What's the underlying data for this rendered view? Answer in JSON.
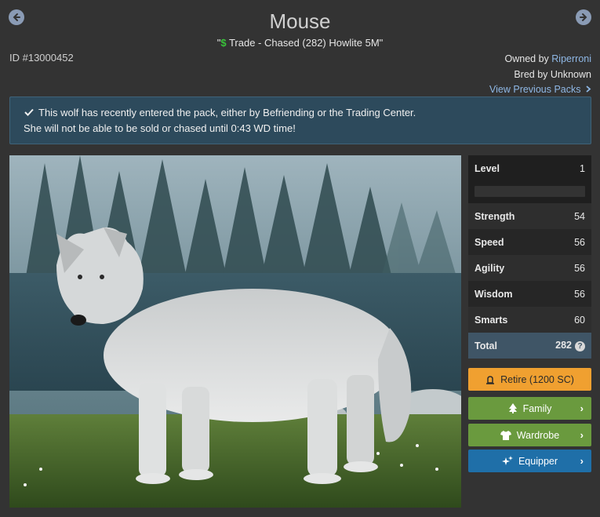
{
  "header": {
    "title": "Mouse",
    "subtitle_prefix": "\"",
    "subtitle_dollar": "$",
    "subtitle_text": " Trade - Chased (282) Howlite 5M\"",
    "wolf_id": "ID #13000452"
  },
  "owner": {
    "owned_by_label": "Owned by ",
    "owner_name": "Riperroni",
    "bred_by": "Bred by Unknown",
    "view_previous": "View Previous Packs"
  },
  "notice": {
    "line1": "This wolf has recently entered the pack, either by Befriending or the Trading Center.",
    "line2": "She will not be able to be sold or chased until 0:43 WD time!"
  },
  "stats": {
    "level_label": "Level",
    "level_value": "1",
    "xp_fraction": 0,
    "rows": [
      {
        "label": "Strength",
        "value": "54"
      },
      {
        "label": "Speed",
        "value": "56"
      },
      {
        "label": "Agility",
        "value": "56"
      },
      {
        "label": "Wisdom",
        "value": "56"
      },
      {
        "label": "Smarts",
        "value": "60"
      }
    ],
    "total_label": "Total",
    "total_value": "282",
    "help_glyph": "?"
  },
  "buttons": {
    "retire": "Retire (1200 SC)",
    "family": "Family",
    "wardrobe": "Wardrobe",
    "equipper": "Equipper"
  },
  "colors": {
    "background": "#333333",
    "notice_bg": "#2d4a5c",
    "retire": "#f0a030",
    "green": "#6a9a3e",
    "blue": "#1f6fa8",
    "link": "#8fb8e6"
  }
}
